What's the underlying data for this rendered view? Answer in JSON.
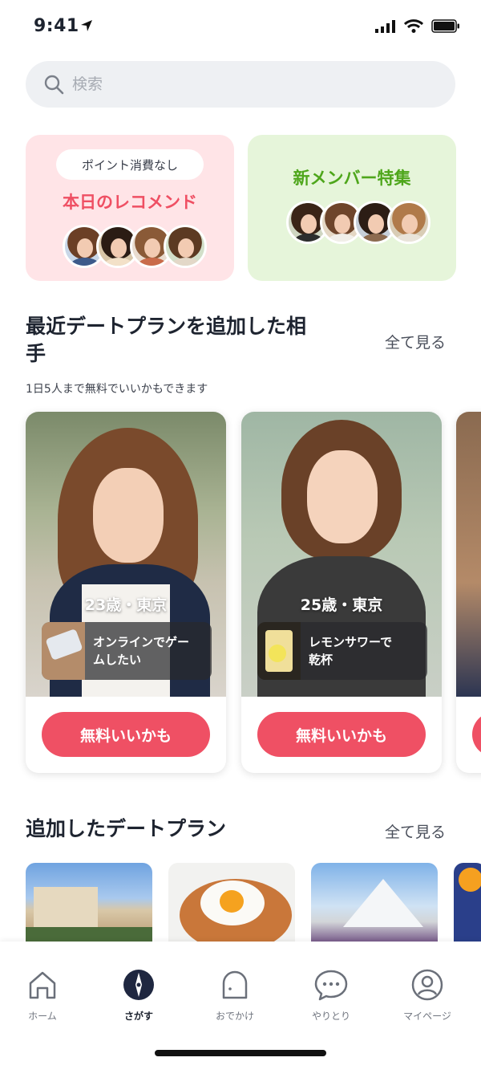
{
  "status_bar": {
    "time": "9:41"
  },
  "search": {
    "placeholder": "検索"
  },
  "features": {
    "recommend": {
      "badge": "ポイント消費なし",
      "title": "本日のレコメンド"
    },
    "new_members": {
      "title": "新メンバー特集"
    }
  },
  "recent_section": {
    "title_line1": "最近デートプランを追加した相",
    "title_line2": "手",
    "see_all": "全て見る",
    "subtitle": "1日5人まで無料でいいかもできます"
  },
  "profiles": [
    {
      "age_location": "23歳・東京",
      "plan_line1": "オンラインでゲー",
      "plan_line2": "ムしたい",
      "button": "無料いいかも"
    },
    {
      "age_location": "25歳・東京",
      "plan_line1": "レモンサワーで",
      "plan_line2": "乾杯",
      "button": "無料いいかも"
    }
  ],
  "plans_section": {
    "title": "追加したデートプラン",
    "see_all": "全て見る"
  },
  "tabbar": {
    "items": [
      {
        "label": "ホーム",
        "icon": "home-icon"
      },
      {
        "label": "さがす",
        "icon": "compass-icon"
      },
      {
        "label": "おでかけ",
        "icon": "outing-icon"
      },
      {
        "label": "やりとり",
        "icon": "chat-icon"
      },
      {
        "label": "マイページ",
        "icon": "user-icon"
      }
    ],
    "active": "さがす"
  },
  "colors": {
    "accent": "#ef5064",
    "pink_bg": "#ffe4e7",
    "green_bg": "#e6f5da",
    "green_text": "#4ea61b"
  }
}
